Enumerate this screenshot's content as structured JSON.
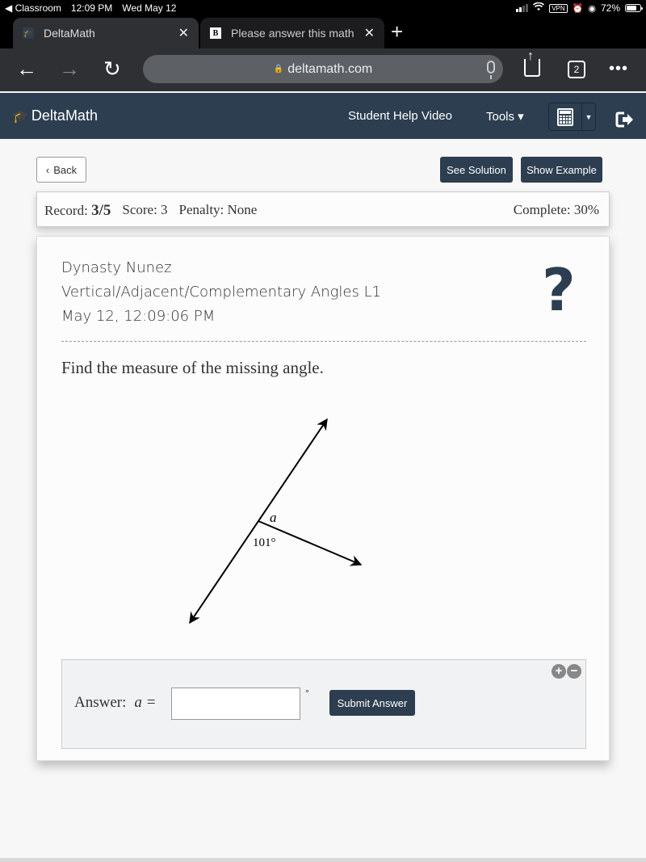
{
  "status_bar": {
    "back_app": "◀ Classroom",
    "time": "12:09 PM",
    "date": "Wed May 12",
    "vpn": "VPN",
    "battery": "72%",
    "battery_level": 0.72
  },
  "browser": {
    "tabs": [
      {
        "title": "DeltaMath",
        "favicon": "graduation-cap-icon",
        "active": true
      },
      {
        "title": "Please answer this math",
        "favicon": "B",
        "active": false
      }
    ],
    "url": "deltamath.com",
    "tab_count": "2"
  },
  "navbar": {
    "brand": "DeltaMath",
    "links": [
      "Student Help Video",
      "Tools ▾"
    ],
    "calc_caret": "▼"
  },
  "actions": {
    "back": "Back",
    "see_solution": "See Solution",
    "show_example": "Show Example"
  },
  "record": {
    "record_label": "Record:",
    "record_value": "3/5",
    "score": "Score: 3",
    "penalty": "Penalty: None",
    "complete": "Complete: 30%"
  },
  "problem": {
    "student": "Dynasty Nunez",
    "assignment": "Vertical/Adjacent/Complementary Angles L1",
    "timestamp": "May 12, 12:09:06 PM",
    "help_symbol": "?",
    "prompt": "Find the measure of the missing angle.",
    "diagram": {
      "unknown_label": "a",
      "given_angle_label": "101°",
      "given_angle": 101
    }
  },
  "answer": {
    "label": "Answer:",
    "variable": "a =",
    "value": "",
    "placeholder": "",
    "unit": "°",
    "submit": "Submit Answer",
    "zoom_in": "+",
    "zoom_out": "−"
  }
}
